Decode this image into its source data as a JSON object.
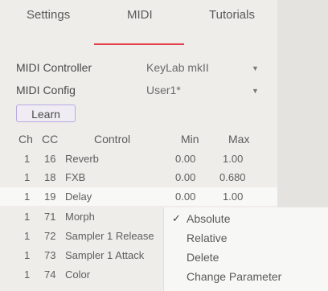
{
  "tabs": {
    "settings": "Settings",
    "midi": "MIDI",
    "tutorials": "Tutorials"
  },
  "controller": {
    "label": "MIDI Controller",
    "value": "KeyLab mkII"
  },
  "config": {
    "label": "MIDI Config",
    "value": "User1*"
  },
  "learn_label": "Learn",
  "table": {
    "headers": {
      "ch": "Ch",
      "cc": "CC",
      "control": "Control",
      "min": "Min",
      "max": "Max"
    },
    "rows": [
      {
        "ch": "1",
        "cc": "16",
        "control": "Reverb",
        "min": "0.00",
        "max": "1.00"
      },
      {
        "ch": "1",
        "cc": "18",
        "control": "FXB",
        "min": "0.00",
        "max": "0.680"
      },
      {
        "ch": "1",
        "cc": "19",
        "control": "Delay",
        "min": "0.00",
        "max": "1.00"
      },
      {
        "ch": "1",
        "cc": "71",
        "control": "Morph",
        "min": "",
        "max": ""
      },
      {
        "ch": "1",
        "cc": "72",
        "control": "Sampler 1 Release",
        "min": "",
        "max": ""
      },
      {
        "ch": "1",
        "cc": "73",
        "control": "Sampler 1 Attack",
        "min": "",
        "max": ""
      },
      {
        "ch": "1",
        "cc": "74",
        "control": "Color",
        "min": "",
        "max": ""
      }
    ]
  },
  "context_menu": {
    "items": [
      {
        "label": "Absolute",
        "checked": true,
        "check_glyph": "✓"
      },
      {
        "label": "Relative",
        "checked": false
      },
      {
        "label": "Delete",
        "checked": false
      },
      {
        "label": "Change Parameter",
        "checked": false
      }
    ]
  },
  "colors": {
    "accent": "#e2404a",
    "learn_border": "#b9a9e2"
  }
}
